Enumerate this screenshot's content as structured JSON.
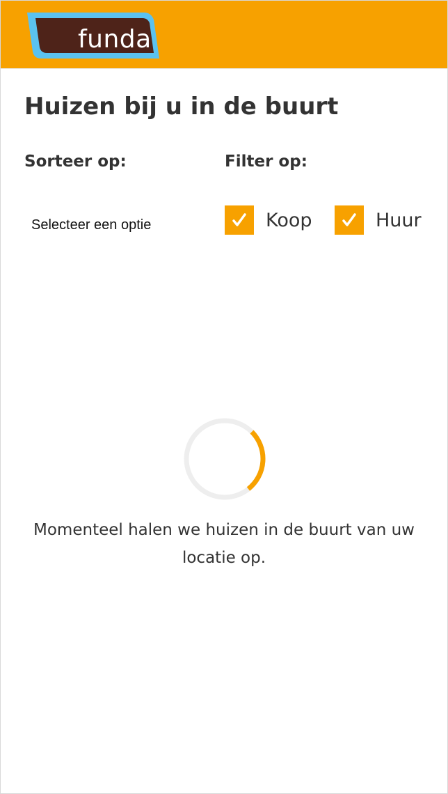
{
  "header": {
    "logo_text": "funda"
  },
  "page": {
    "title": "Huizen bij u in de buurt"
  },
  "sort": {
    "heading": "Sorteer op:",
    "selected_option": "Selecteer een optie"
  },
  "filter": {
    "heading": "Filter op:",
    "options": [
      {
        "label": "Koop",
        "checked": true
      },
      {
        "label": "Huur",
        "checked": true
      }
    ]
  },
  "loading": {
    "message": "Momenteel halen we huizen in de buurt van uw locatie op."
  },
  "colors": {
    "brand_orange": "#f7a100",
    "logo_blue": "#5bc2f0",
    "logo_brown": "#4e2319",
    "text": "#333333",
    "spinner_track": "#eeeeee"
  },
  "icons": {
    "logo": "funda-logo",
    "checkbox": "checkmark-icon",
    "loading": "loading-spinner"
  }
}
